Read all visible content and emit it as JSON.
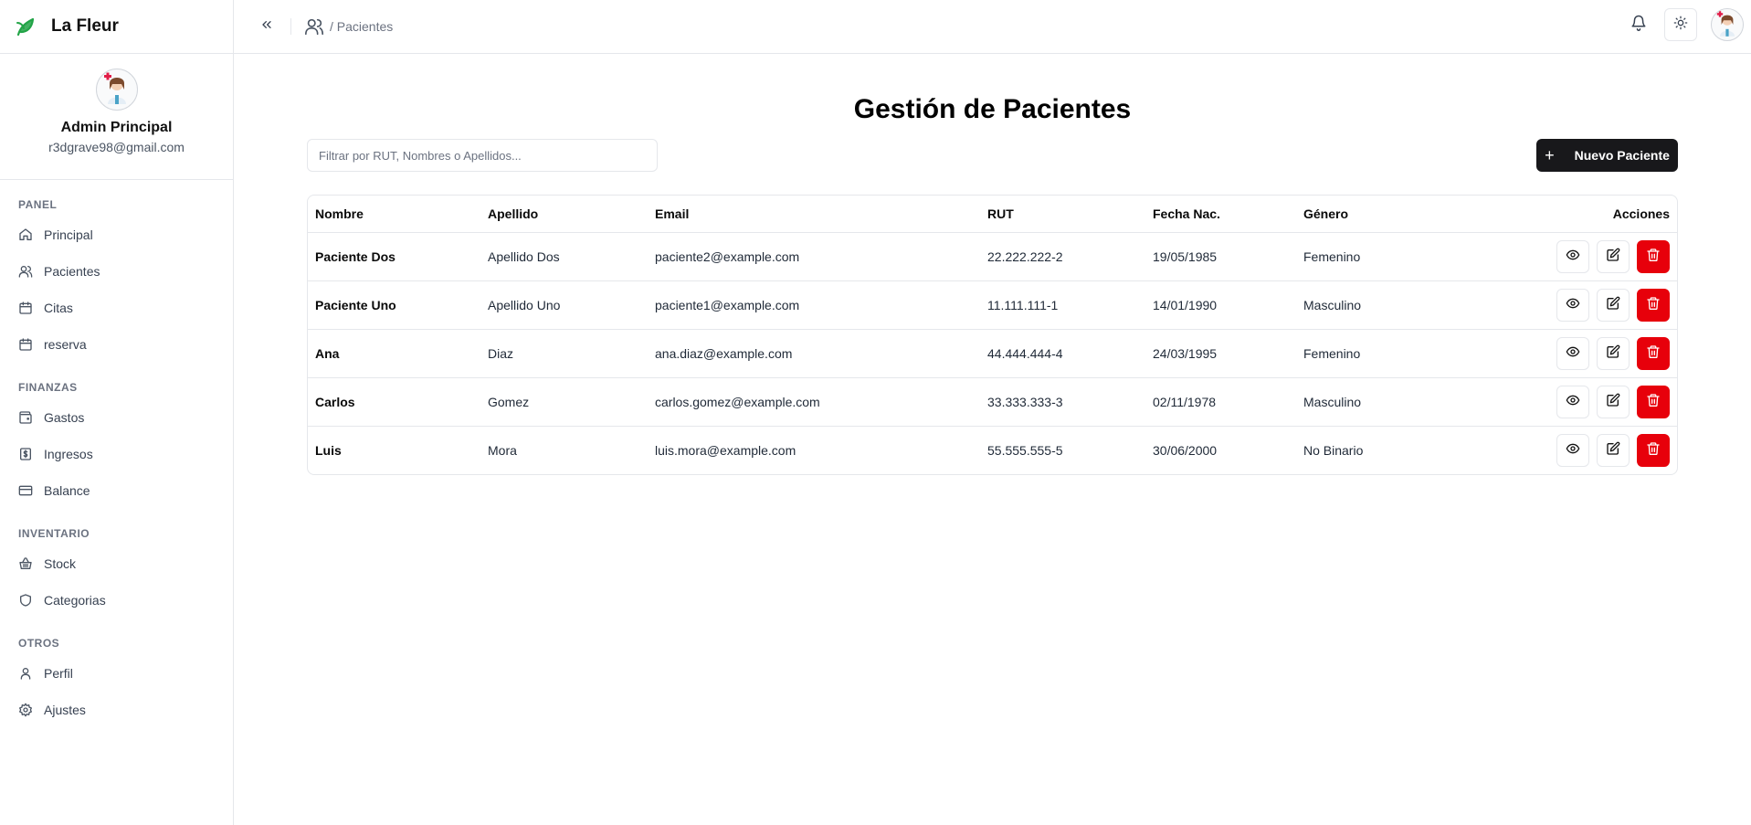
{
  "app": {
    "name": "La Fleur"
  },
  "profile": {
    "name": "Admin Principal",
    "email": "r3dgrave98@gmail.com"
  },
  "sidebar": {
    "sections": [
      {
        "title": "PANEL",
        "items": [
          {
            "label": "Principal",
            "icon": "home-icon"
          },
          {
            "label": "Pacientes",
            "icon": "users-icon"
          },
          {
            "label": "Citas",
            "icon": "calendar-icon"
          },
          {
            "label": "reserva",
            "icon": "calendar-icon"
          }
        ]
      },
      {
        "title": "FINANZAS",
        "items": [
          {
            "label": "Gastos",
            "icon": "wallet-icon"
          },
          {
            "label": "Ingresos",
            "icon": "dollar-icon"
          },
          {
            "label": "Balance",
            "icon": "credit-card-icon"
          }
        ]
      },
      {
        "title": "INVENTARIO",
        "items": [
          {
            "label": "Stock",
            "icon": "basket-icon"
          },
          {
            "label": "Categorias",
            "icon": "shield-icon"
          }
        ]
      },
      {
        "title": "OTROS",
        "items": [
          {
            "label": "Perfil",
            "icon": "user-icon"
          },
          {
            "label": "Ajustes",
            "icon": "gear-icon"
          }
        ]
      }
    ]
  },
  "header": {
    "breadcrumb": "/ Pacientes"
  },
  "page": {
    "title": "Gestión de Pacientes",
    "filter_placeholder": "Filtrar por RUT, Nombres o Apellidos...",
    "new_button": "Nuevo Paciente"
  },
  "table": {
    "headers": {
      "nombre": "Nombre",
      "apellido": "Apellido",
      "email": "Email",
      "rut": "RUT",
      "fecha": "Fecha Nac.",
      "genero": "Género",
      "acciones": "Acciones"
    },
    "rows": [
      {
        "nombre": "Paciente Dos",
        "apellido": "Apellido Dos",
        "email": "paciente2@example.com",
        "rut": "22.222.222-2",
        "fecha": "19/05/1985",
        "genero": "Femenino"
      },
      {
        "nombre": "Paciente Uno",
        "apellido": "Apellido Uno",
        "email": "paciente1@example.com",
        "rut": "11.111.111-1",
        "fecha": "14/01/1990",
        "genero": "Masculino"
      },
      {
        "nombre": "Ana",
        "apellido": "Diaz",
        "email": "ana.diaz@example.com",
        "rut": "44.444.444-4",
        "fecha": "24/03/1995",
        "genero": "Femenino"
      },
      {
        "nombre": "Carlos",
        "apellido": "Gomez",
        "email": "carlos.gomez@example.com",
        "rut": "33.333.333-3",
        "fecha": "02/11/1978",
        "genero": "Masculino"
      },
      {
        "nombre": "Luis",
        "apellido": "Mora",
        "email": "luis.mora@example.com",
        "rut": "55.555.555-5",
        "fecha": "30/06/2000",
        "genero": "No Binario"
      }
    ]
  },
  "colors": {
    "brand_leaf": "#22a447",
    "primary_button": "#18181b",
    "danger": "#e7000b"
  }
}
